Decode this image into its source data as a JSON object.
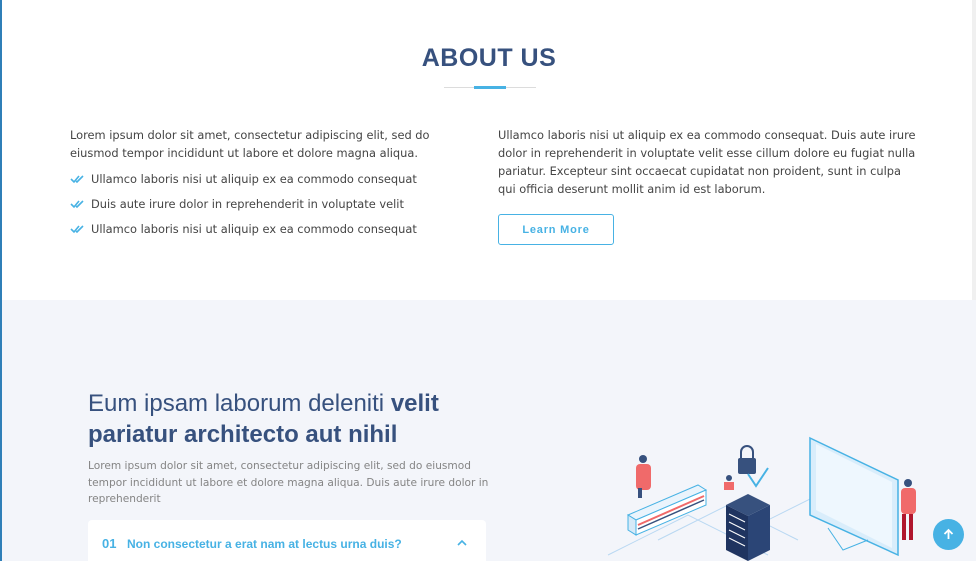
{
  "about": {
    "title": "ABOUT US",
    "left_paragraph": "Lorem ipsum dolor sit amet, consectetur adipiscing elit, sed do eiusmod tempor incididunt ut labore et dolore magna aliqua.",
    "checklist": [
      "Ullamco laboris nisi ut aliquip ex ea commodo consequat",
      "Duis aute irure dolor in reprehenderit in voluptate velit",
      "Ullamco laboris nisi ut aliquip ex ea commodo consequat"
    ],
    "right_paragraph": "Ullamco laboris nisi ut aliquip ex ea commodo consequat. Duis aute irure dolor in reprehenderit in voluptate velit esse cillum dolore eu fugiat nulla pariatur. Excepteur sint occaecat cupidatat non proident, sunt in culpa qui officia deserunt mollit anim id est laborum.",
    "button_label": "Learn More"
  },
  "why": {
    "heading_light": "Eum ipsam laborum deleniti ",
    "heading_bold": "velit pariatur architecto aut nihil",
    "paragraph": "Lorem ipsum dolor sit amet, consectetur adipiscing elit, sed do eiusmod tempor incididunt ut labore et dolore magna aliqua. Duis aute irure dolor in reprehenderit",
    "faq": [
      {
        "number": "01",
        "question": "Non consectetur a erat nam at lectus urna duis?"
      }
    ]
  },
  "colors": {
    "primary": "#37517e",
    "accent": "#47b2e4",
    "section_bg": "#f3f5fa"
  },
  "icons": {
    "check": "double-check-icon",
    "chevron": "chevron-up-icon",
    "scroll_top": "arrow-up-icon"
  }
}
